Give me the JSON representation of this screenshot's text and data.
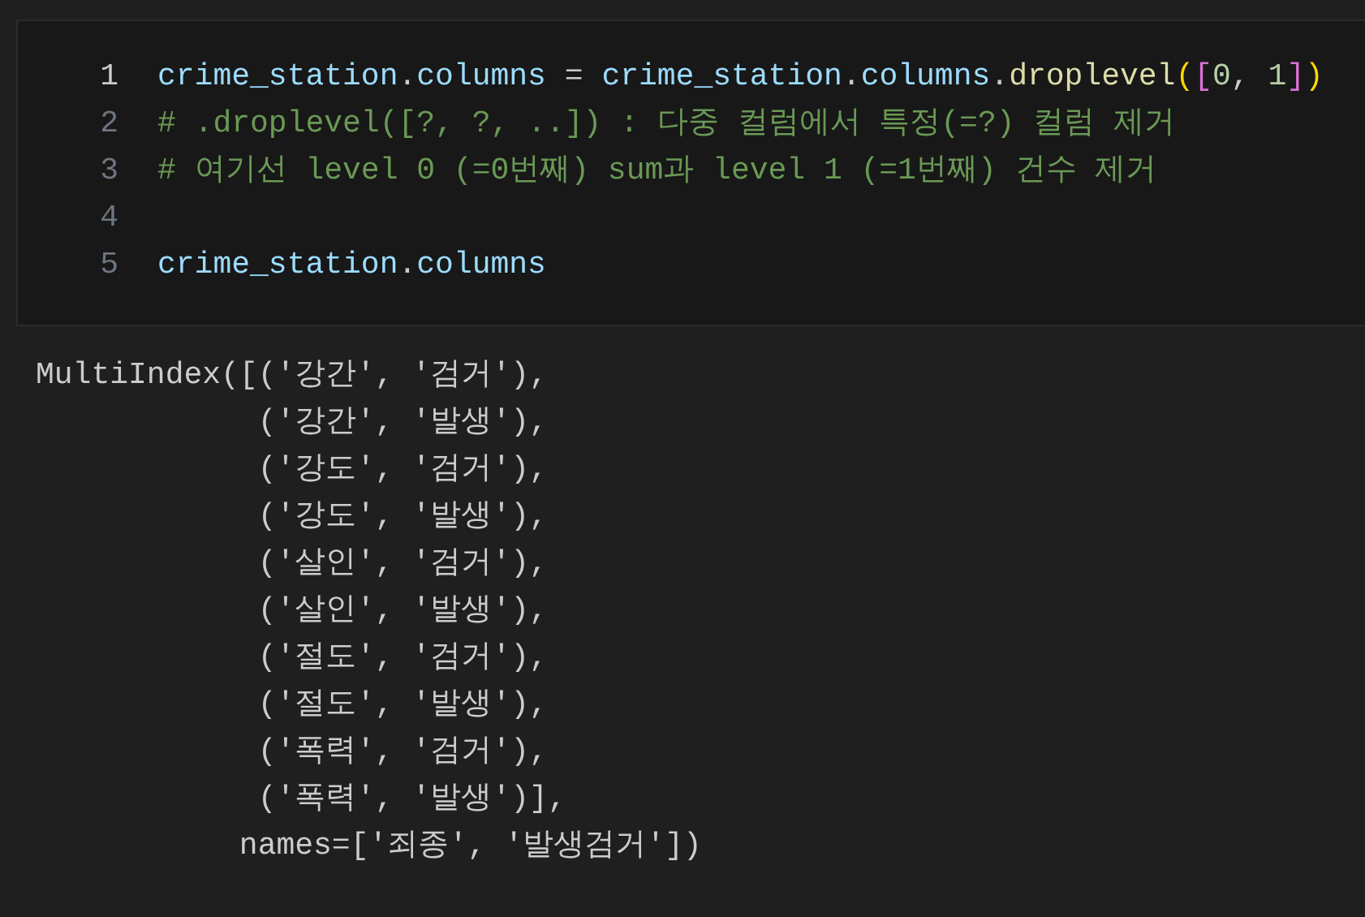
{
  "code_cell": {
    "lines": [
      {
        "number": "1",
        "current": true,
        "tokens": [
          {
            "kind": "variable",
            "text": "crime_station"
          },
          {
            "kind": "plain",
            "text": "."
          },
          {
            "kind": "variable",
            "text": "columns"
          },
          {
            "kind": "plain",
            "text": " = "
          },
          {
            "kind": "variable",
            "text": "crime_station"
          },
          {
            "kind": "plain",
            "text": "."
          },
          {
            "kind": "variable",
            "text": "columns"
          },
          {
            "kind": "plain",
            "text": "."
          },
          {
            "kind": "function",
            "text": "droplevel"
          },
          {
            "kind": "bracket1",
            "text": "("
          },
          {
            "kind": "bracket2",
            "text": "["
          },
          {
            "kind": "number",
            "text": "0"
          },
          {
            "kind": "plain",
            "text": ", "
          },
          {
            "kind": "number",
            "text": "1"
          },
          {
            "kind": "bracket2",
            "text": "]"
          },
          {
            "kind": "bracket1",
            "text": ")"
          }
        ]
      },
      {
        "number": "2",
        "current": false,
        "tokens": [
          {
            "kind": "comment",
            "text": "# .droplevel([?, ?, ..]) : 다중 컬럼에서 특정(=?) 컬럼 제거"
          }
        ]
      },
      {
        "number": "3",
        "current": false,
        "tokens": [
          {
            "kind": "comment",
            "text": "# 여기선 level 0 (=0번째) sum과 level 1 (=1번째) 건수 제거"
          }
        ]
      },
      {
        "number": "4",
        "current": false
      },
      {
        "number": "5",
        "current": false,
        "tokens": [
          {
            "kind": "variable",
            "text": "crime_station"
          },
          {
            "kind": "plain",
            "text": "."
          },
          {
            "kind": "variable",
            "text": "columns"
          }
        ]
      }
    ]
  },
  "output": {
    "lines": [
      "MultiIndex([('강간', '검거'),",
      "            ('강간', '발생'),",
      "            ('강도', '검거'),",
      "            ('강도', '발생'),",
      "            ('살인', '검거'),",
      "            ('살인', '발생'),",
      "            ('절도', '검거'),",
      "            ('절도', '발생'),",
      "            ('폭력', '검거'),",
      "            ('폭력', '발생')],",
      "           names=['죄종', '발생검거'])"
    ]
  }
}
